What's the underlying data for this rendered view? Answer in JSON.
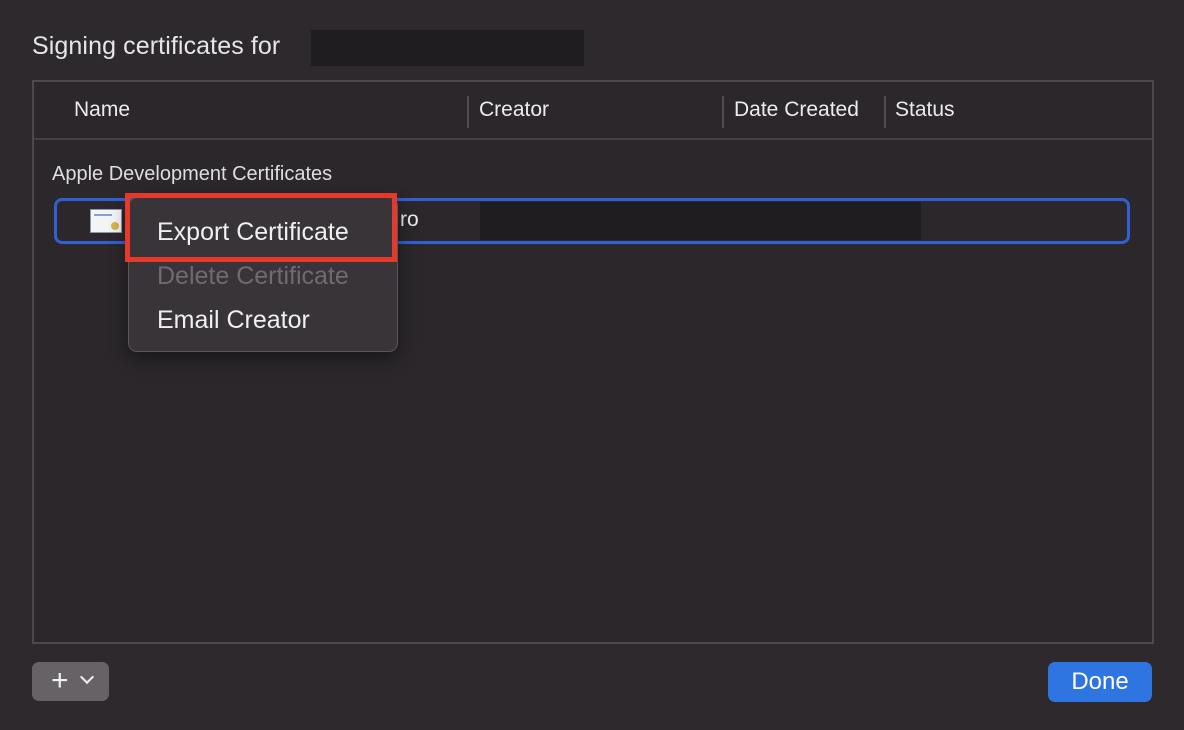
{
  "dialog": {
    "title": "Signing certificates for"
  },
  "table": {
    "columns": [
      "Name",
      "Creator",
      "Date Created",
      "Status"
    ],
    "section_label": "Apple Development Certificates",
    "rows": [
      {
        "name_visible_fragment": "ro"
      }
    ]
  },
  "context_menu": {
    "items": [
      {
        "label": "Export Certificate",
        "enabled": true
      },
      {
        "label": "Delete Certificate",
        "enabled": false
      },
      {
        "label": "Email Creator",
        "enabled": true
      }
    ]
  },
  "footer": {
    "add_icon": "plus-icon",
    "dropdown_icon": "chevron-down-icon",
    "done_label": "Done"
  },
  "colors": {
    "background": "#2d292c",
    "selection_border": "#2f60d6",
    "highlight_box": "#e4392b",
    "primary_button": "#2f75e1"
  }
}
